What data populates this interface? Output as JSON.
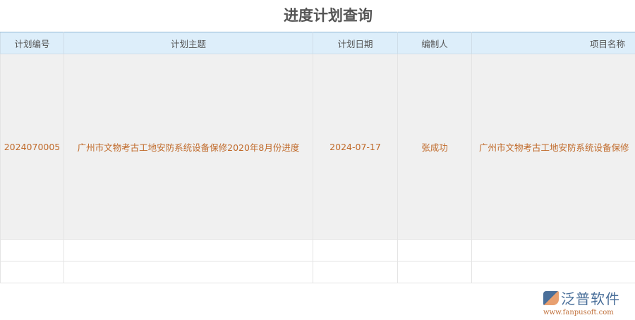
{
  "title": "进度计划查询",
  "columns": [
    "计划编号",
    "计划主题",
    "计划日期",
    "编制人",
    "项目名称"
  ],
  "rows": [
    [
      "2024070005",
      "广州市文物考古工地安防系统设备保修2020年8月份进度",
      "2024-07-17",
      "张成功",
      "广州市文物考古工地安防系统设备保修"
    ]
  ],
  "logo": {
    "name": "泛普软件",
    "url": "www.fanpusoft.com"
  }
}
